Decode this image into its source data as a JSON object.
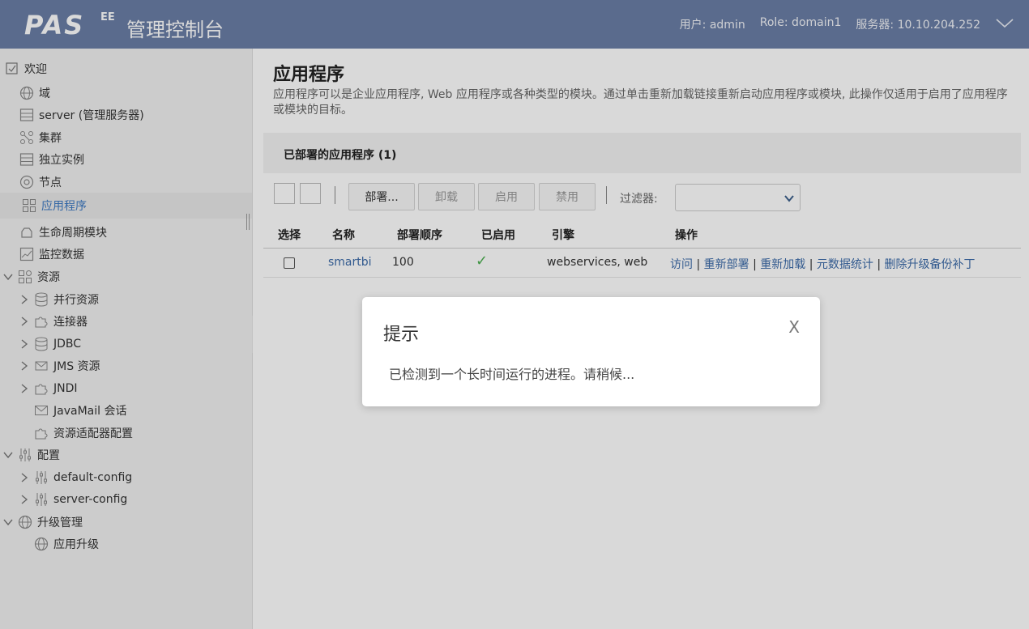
{
  "header": {
    "logo": "PAS",
    "logo_sup": "EE",
    "console_title": "管理控制台",
    "user": "用户: admin",
    "role": "Role: domain1",
    "server": "服务器: 10.10.204.252"
  },
  "sidebar": {
    "items": [
      {
        "label": "欢迎",
        "icon": "welcome-check-icon"
      },
      {
        "label": "域",
        "icon": "globe-icon"
      },
      {
        "label": "server (管理服务器)",
        "icon": "server-icon"
      },
      {
        "label": "集群",
        "icon": "cluster-icon"
      },
      {
        "label": "独立实例",
        "icon": "server-icon"
      },
      {
        "label": "节点",
        "icon": "node-icon"
      },
      {
        "label": "应用程序",
        "icon": "grid-icon"
      },
      {
        "label": "生命周期模块",
        "icon": "module-icon"
      },
      {
        "label": "监控数据",
        "icon": "chart-icon"
      },
      {
        "label": "资源",
        "icon": "resources-icon"
      },
      {
        "label": "并行资源",
        "icon": "database-icon"
      },
      {
        "label": "连接器",
        "icon": "puzzle-icon"
      },
      {
        "label": "JDBC",
        "icon": "database-icon"
      },
      {
        "label": "JMS 资源",
        "icon": "jms-icon"
      },
      {
        "label": "JNDI",
        "icon": "puzzle-icon"
      },
      {
        "label": "JavaMail 会话",
        "icon": "mail-icon"
      },
      {
        "label": "资源适配器配置",
        "icon": "puzzle-icon"
      },
      {
        "label": "配置",
        "icon": "sliders-icon"
      },
      {
        "label": "default-config",
        "icon": "sliders-icon"
      },
      {
        "label": "server-config",
        "icon": "sliders-icon"
      },
      {
        "label": "升级管理",
        "icon": "globe-icon"
      },
      {
        "label": "应用升级",
        "icon": "globe-icon"
      }
    ]
  },
  "main": {
    "title": "应用程序",
    "description": "应用程序可以是企业应用程序, Web 应用程序或各种类型的模块。通过单击重新加载链接重新启动应用程序或模块, 此操作仅适用于启用了应用程序或模块的目标。",
    "panel_title": "已部署的应用程序 (1)",
    "toolbar": {
      "deploy": "部署...",
      "undeploy": "卸载",
      "enable": "启用",
      "disable": "禁用",
      "filter_label": "过滤器:",
      "filter_value": ""
    },
    "table": {
      "headers": [
        "选择",
        "名称",
        "部署顺序",
        "已启用",
        "引擎",
        "操作"
      ],
      "rows": [
        {
          "name": "smartbi",
          "order": "100",
          "enabled": "✓",
          "engine": "webservices, web",
          "actions": [
            "访问",
            "重新部署",
            "重新加载",
            "元数据统计",
            "删除升级备份补丁"
          ],
          "separator": "|"
        }
      ]
    }
  },
  "dialog": {
    "title": "提示",
    "close": "X",
    "message": "已检测到一个长时间运行的进程。请稍候..."
  },
  "colors": {
    "header_bg": "#6a7ea6",
    "link": "#3b6aa8",
    "active_nav": "#3b78c2",
    "check_green": "#4caf50"
  }
}
